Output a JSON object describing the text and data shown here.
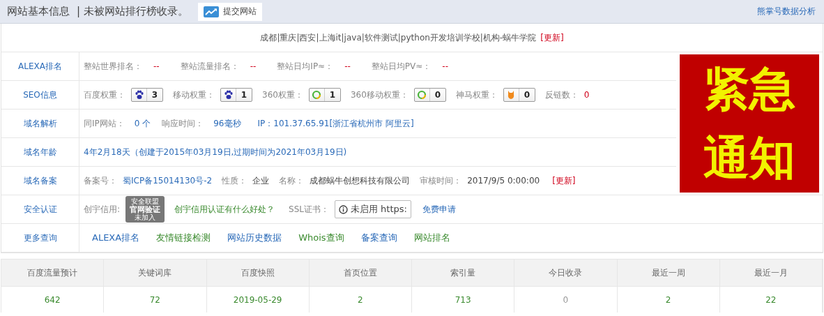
{
  "header": {
    "title": "网站基本信息",
    "subtitle": "| 未被网站排行榜收录。",
    "submit_button": "提交网站",
    "right_link": "熊掌号数据分析"
  },
  "site_title": {
    "text": "成都|重庆|西安|上海it|java|软件测试|python开发培训学校|机构-蜗牛学院",
    "update_link": "[更新]"
  },
  "notice_banner": {
    "lines": [
      "紧急",
      "通知"
    ]
  },
  "rows": [
    {
      "label": "ALEXA排名",
      "kind": "pairs",
      "items": [
        {
          "label": "整站世界排名：",
          "value": "--"
        },
        {
          "label": "整站流量排名：",
          "value": "--"
        },
        {
          "label": "整站日均IP≈：",
          "value": "--"
        },
        {
          "label": "整站日均PV≈：",
          "value": "--"
        }
      ]
    },
    {
      "label": "SEO信息",
      "kind": "weights",
      "items": [
        {
          "label": "百度权重：",
          "kind": "baidu",
          "value": "3"
        },
        {
          "label": "移动权重：",
          "kind": "baidu",
          "value": "1"
        },
        {
          "label": "360权重：",
          "kind": "so360",
          "value": "1"
        },
        {
          "label": "360移动权重：",
          "kind": "so360",
          "value": "0"
        },
        {
          "label": "神马权重：",
          "kind": "shenma",
          "value": "0"
        }
      ],
      "backlinks": {
        "label": "反链数：",
        "value": "0"
      }
    },
    {
      "label": "域名解析",
      "kind": "dns",
      "items": [
        {
          "label": "同IP网站：",
          "value": "0 个"
        },
        {
          "label": "响应时间：",
          "value": "96毫秒"
        }
      ],
      "ip": "IP：101.37.65.91[浙江省杭州市 阿里云]"
    },
    {
      "label": "域名年龄",
      "kind": "age",
      "text": "4年2月18天（创建于2015年03月19日,过期时间为2021年03月19日)"
    },
    {
      "label": "域名备案",
      "kind": "icp",
      "items": [
        {
          "label": "备案号：",
          "value": "蜀ICP备15014130号-2",
          "kind": "link"
        },
        {
          "label": "性质：",
          "value": "企业",
          "kind": "text"
        },
        {
          "label": "名称：",
          "value": "成都蜗牛创想科技有限公司",
          "kind": "text"
        },
        {
          "label": "审核时间：",
          "value": "2017/9/5 0:00:00",
          "kind": "text"
        }
      ],
      "update_link": "[更新]"
    },
    {
      "label": "安全认证",
      "kind": "security",
      "credit_label": "创宇信用:",
      "seal": [
        "安全联盟",
        "官网验证",
        "未加入"
      ],
      "credit_link": "创宇信用认证有什么好处？",
      "ssl_label": "SSL证书：",
      "ssl_status": "未启用 https:",
      "ssl_link": "免费申请"
    },
    {
      "label": "更多查询",
      "kind": "links",
      "links": [
        {
          "text": "ALEXA排名",
          "color": "#2a6ab8"
        },
        {
          "text": "友情链接检测",
          "color": "#3a8a2e"
        },
        {
          "text": "网站历史数据",
          "color": "#2a6ab8"
        },
        {
          "text": "Whois查询",
          "color": "#3a8a2e"
        },
        {
          "text": "备案查询",
          "color": "#2a6ab8"
        },
        {
          "text": "网站排名",
          "color": "#3a8a2e"
        }
      ]
    }
  ],
  "stats": {
    "columns": [
      "百度流量预计",
      "关键词库",
      "百度快照",
      "首页位置",
      "索引量",
      "今日收录",
      "最近一周",
      "最近一月"
    ],
    "values": [
      {
        "text": "642",
        "color": "#3a8a2e"
      },
      {
        "text": "72",
        "color": "#3a8a2e"
      },
      {
        "text": "2019-05-29",
        "color": "#3a8a2e"
      },
      {
        "text": "2",
        "color": "#3a8a2e"
      },
      {
        "text": "713",
        "color": "#3a8a2e"
      },
      {
        "text": "0",
        "color": "#999999"
      },
      {
        "text": "2",
        "color": "#3a8a2e"
      },
      {
        "text": "22",
        "color": "#3a8a2e"
      }
    ]
  }
}
